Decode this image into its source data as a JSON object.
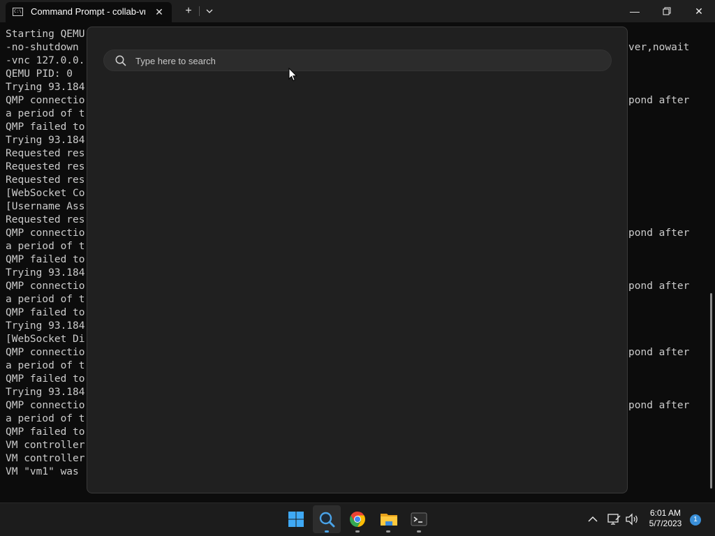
{
  "window": {
    "tab_title": "Command Prompt - collab-vn",
    "tab_icon_text": "C:\\",
    "close_tab_glyph": "✕",
    "new_tab_glyph": "+",
    "dropdown_glyph": "⌄",
    "minimize_glyph": "—",
    "maximize_glyph": "⧉",
    "close_glyph": "✕"
  },
  "terminal": {
    "left_lines": [
      "Starting QEMU",
      "-no-shutdown",
      "-vnc 127.0.0.",
      "QEMU PID: 0",
      "Trying 93.184",
      "QMP connectio",
      "a period of t",
      "QMP failed to",
      "Trying 93.184",
      "Requested res",
      "Requested res",
      "Requested res",
      "[WebSocket Co",
      "[Username Ass",
      "Requested res",
      "QMP connectio",
      "a period of t",
      "QMP failed to",
      "Trying 93.184",
      "QMP connectio",
      "a period of t",
      "QMP failed to",
      "Trying 93.184",
      "[WebSocket Di",
      "QMP connectio",
      "a period of t",
      "QMP failed to",
      "Trying 93.184",
      "QMP connectio",
      "a period of t",
      "QMP failed to",
      "VM controller",
      "VM controller",
      "VM \"vm1\" was"
    ],
    "right_fragments": [
      {
        "line": 1,
        "text": "ver,nowait"
      },
      {
        "line": 5,
        "text": "pond after"
      },
      {
        "line": 15,
        "text": "pond after"
      },
      {
        "line": 19,
        "text": "pond after"
      },
      {
        "line": 24,
        "text": "pond after"
      },
      {
        "line": 28,
        "text": "pond after"
      }
    ]
  },
  "search": {
    "placeholder": "Type here to search",
    "value": ""
  },
  "taskbar": {
    "apps": [
      {
        "name": "start-button",
        "icon": "windows-logo-icon"
      },
      {
        "name": "search-app",
        "icon": "search-icon",
        "active": true
      },
      {
        "name": "chrome-app",
        "icon": "chrome-icon"
      },
      {
        "name": "file-explorer-app",
        "icon": "folder-icon"
      },
      {
        "name": "terminal-app",
        "icon": "terminal-icon"
      }
    ],
    "tray": {
      "chevron_glyph": "^",
      "time": "6:01 AM",
      "date": "5/7/2023",
      "notification_count": "1"
    }
  },
  "colors": {
    "accent": "#3a8fd8",
    "terminal_text": "#cccccc",
    "panel_bg": "#202020"
  }
}
